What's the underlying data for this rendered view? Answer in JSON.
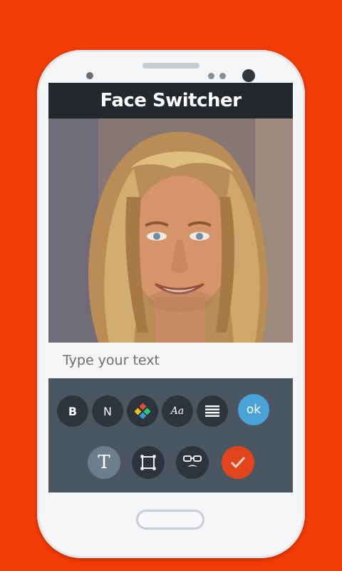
{
  "app": {
    "title": "Face Switcher"
  },
  "caption": {
    "placeholder": "Type your text"
  },
  "format_toolbar": {
    "bold_label": "B",
    "normal_label": "N",
    "color_icon": "color-palette-icon",
    "font_label": "Aa",
    "align_icon": "align-lines-icon",
    "ok_label": "ok"
  },
  "mode_toolbar": {
    "text_label": "T",
    "frame_icon": "frame-icon",
    "face_icon": "face-mask-icon",
    "confirm_icon": "checkmark-icon"
  },
  "colors": {
    "background": "#f23c05",
    "titlebar": "#23282d",
    "toolbar": "#4a5662",
    "ok": "#4aa3d8",
    "confirm": "#e2441b"
  }
}
